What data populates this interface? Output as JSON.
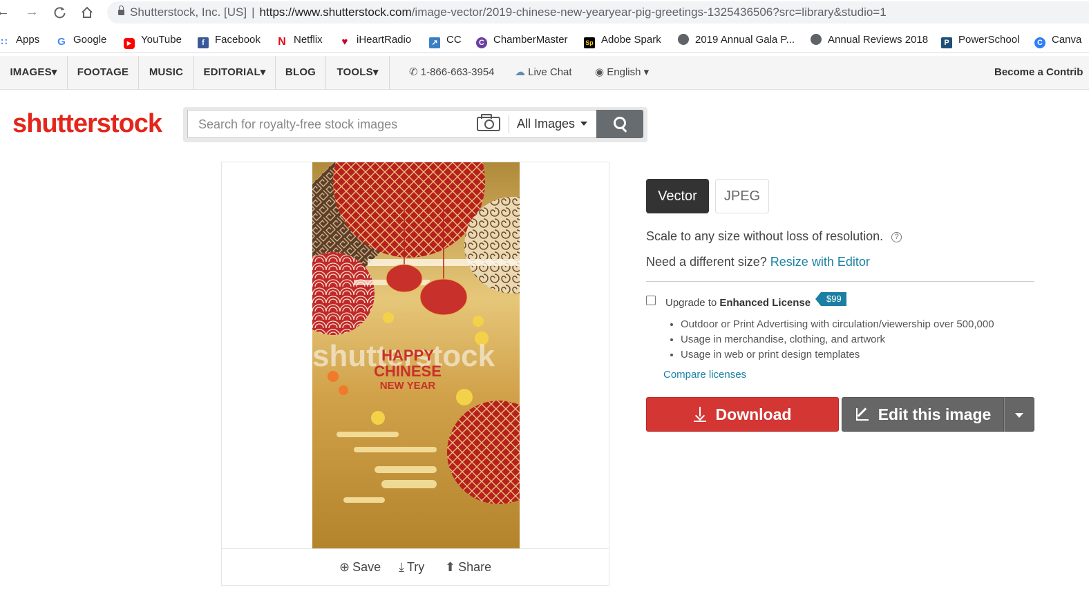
{
  "browser": {
    "site_owner": "Shutterstock, Inc. [US]",
    "url_host": "https://www.shutterstock.com",
    "url_path": "/image-vector/2019-chinese-new-yearyear-pig-greetings-1325436506?src=library&studio=1",
    "bookmarks": [
      {
        "label": "Apps",
        "icon": "apps-grid-icon",
        "color": "#4285f4"
      },
      {
        "label": "Google",
        "icon": "google-icon",
        "color": "#4285f4"
      },
      {
        "label": "YouTube",
        "icon": "youtube-icon",
        "color": "#ff0000"
      },
      {
        "label": "Facebook",
        "icon": "facebook-icon",
        "color": "#3b5998"
      },
      {
        "label": "Netflix",
        "icon": "netflix-icon",
        "color": "#e50914"
      },
      {
        "label": "iHeartRadio",
        "icon": "iheartradio-icon",
        "color": "#c6002b"
      },
      {
        "label": "CC",
        "icon": "cc-icon",
        "color": "#3b80c4"
      },
      {
        "label": "ChamberMaster",
        "icon": "chambermaster-icon",
        "color": "#6b3fa0"
      },
      {
        "label": "Adobe Spark",
        "icon": "adobe-spark-icon",
        "color": "#000000"
      },
      {
        "label": "2019 Annual Gala P...",
        "icon": "globe-icon",
        "color": "#5f6368"
      },
      {
        "label": "Annual Reviews 2018",
        "icon": "globe-icon",
        "color": "#5f6368"
      },
      {
        "label": "PowerSchool",
        "icon": "powerschool-icon",
        "color": "#1f4e79"
      },
      {
        "label": "Canva",
        "icon": "canva-icon",
        "color": "#2d7ff9"
      }
    ]
  },
  "sitenav": {
    "tabs": [
      "IMAGES▾",
      "FOOTAGE",
      "MUSIC",
      "EDITORIAL▾",
      "BLOG",
      "TOOLS▾"
    ],
    "phone": "1-866-663-3954",
    "chat": "Live Chat",
    "language": "English ▾",
    "contributor": "Become a Contrib"
  },
  "header": {
    "logo": "shutterstock",
    "search_placeholder": "Search for royalty-free stock images",
    "search_filter": "All Images"
  },
  "image": {
    "watermark": "shutterstock",
    "greeting_line1": "HAPPY",
    "greeting_line2": "CHINESE",
    "greeting_line3": "NEW YEAR",
    "actions": {
      "save": "Save",
      "try": "Try",
      "share": "Share"
    }
  },
  "purchase": {
    "format_selected": "Vector",
    "format_other": "JPEG",
    "scale_text": "Scale to any size without loss of resolution.",
    "help_glyph": "?",
    "size_prompt": "Need a different size?",
    "resize_link": "Resize with Editor",
    "upgrade_prefix": "Upgrade to",
    "upgrade_license": "Enhanced License",
    "upgrade_price": "$99",
    "benefits": [
      "Outdoor or Print Advertising with circulation/viewership over 500,000",
      "Usage in merchandise, clothing, and artwork",
      "Usage in web or print design templates"
    ],
    "compare_link": "Compare licenses",
    "download_label": "Download",
    "edit_label": "Edit this image",
    "accent_red": "#d43634",
    "accent_link": "#1a82a3"
  }
}
